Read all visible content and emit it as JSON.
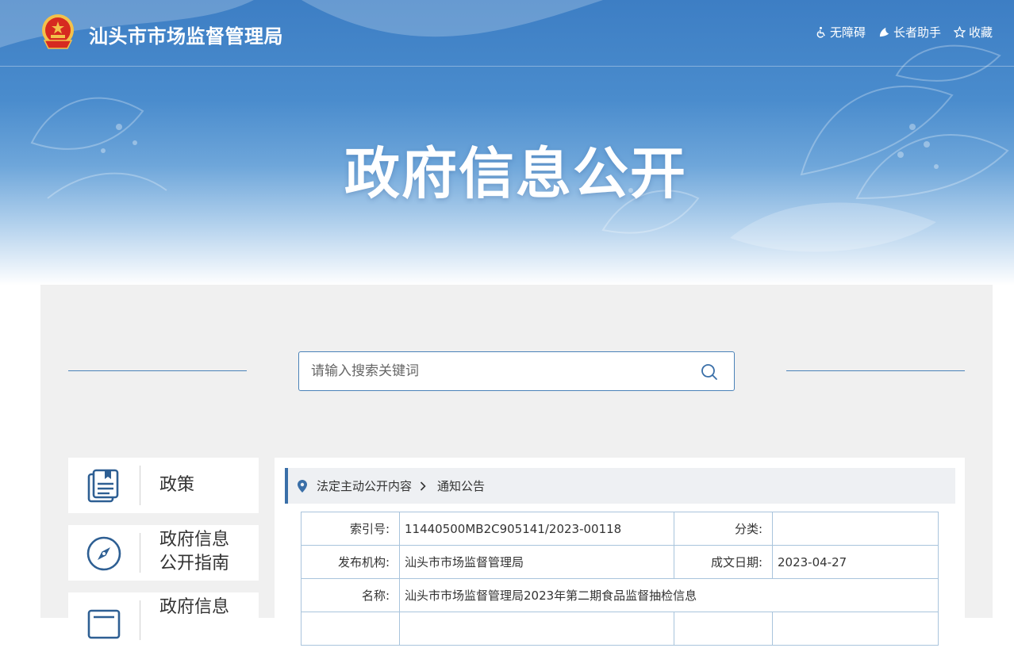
{
  "site": {
    "title": "汕头市市场监督管理局"
  },
  "tools": [
    {
      "icon": "accessibility-icon",
      "label": "无障碍"
    },
    {
      "icon": "elderly-assist-icon",
      "label": "长者助手"
    },
    {
      "icon": "star-icon",
      "label": "收藏"
    }
  ],
  "hero": {
    "title": "政府信息公开"
  },
  "search": {
    "placeholder": "请输入搜索关键词"
  },
  "sidebar": {
    "items": [
      {
        "label_line1": "政策",
        "label_line2": ""
      },
      {
        "label_line1": "政府信息",
        "label_line2": "公开指南"
      },
      {
        "label_line1": "政府信息",
        "label_line2": ""
      }
    ]
  },
  "breadcrumb": {
    "items": [
      "法定主动公开内容",
      "通知公告"
    ]
  },
  "meta": {
    "index_label": "索引号:",
    "index_value": "11440500MB2C905141/2023-00118",
    "category_label": "分类:",
    "category_value": "",
    "publisher_label": "发布机构:",
    "publisher_value": "汕头市市场监督管理局",
    "date_label": "成文日期:",
    "date_value": "2023-04-27",
    "name_label": "名称:",
    "name_value": "汕头市市场监督管理局2023年第二期食品监督抽检信息"
  },
  "colors": {
    "banner_blue": "#4a8ccd",
    "accent": "#3a6fa8",
    "emblem_red": "#d62a20",
    "emblem_gold": "#f3c14a"
  }
}
